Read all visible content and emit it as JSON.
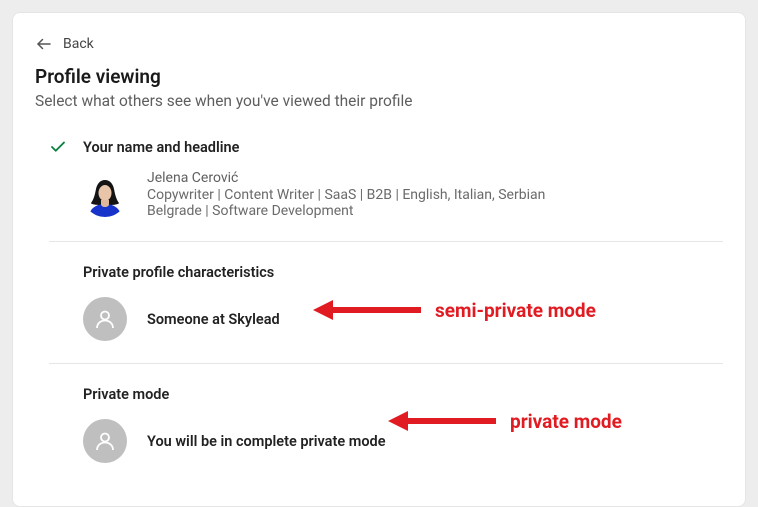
{
  "back": {
    "label": "Back"
  },
  "title": "Profile viewing",
  "subtitle": "Select what others see when you've viewed their profile",
  "options": {
    "your_name": {
      "title": "Your name and headline",
      "name": "Jelena Cerović",
      "headline": "Copywriter | Content Writer | SaaS | B2B | English, Italian, Serbian",
      "subline": "Belgrade | Software Development",
      "selected": true
    },
    "semi_private": {
      "title": "Private profile characteristics",
      "desc": "Someone at Skylead"
    },
    "private": {
      "title": "Private mode",
      "desc": "You will be in complete private mode"
    }
  },
  "annotations": {
    "semi_private": "semi-private mode",
    "private": "private mode"
  },
  "colors": {
    "annotation": "#e11b22",
    "check": "#0a7f3f"
  }
}
